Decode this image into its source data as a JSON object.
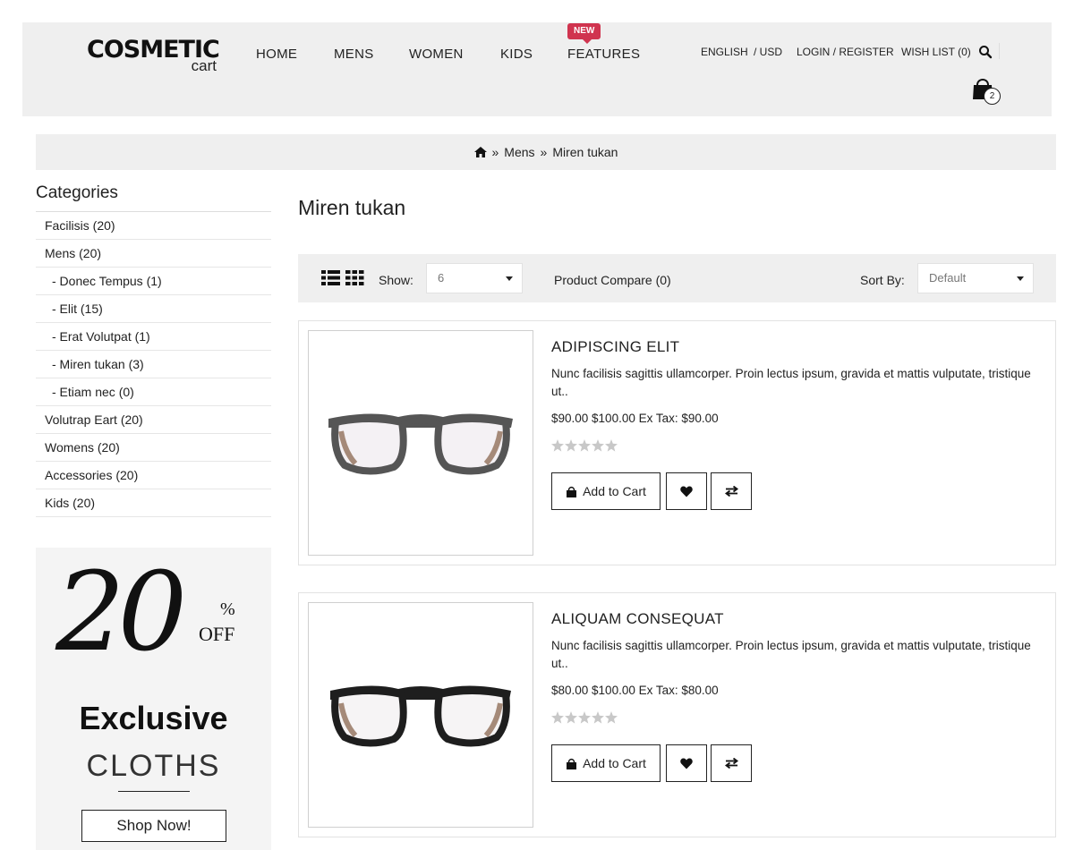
{
  "header": {
    "logo": {
      "main": "COSMETIC",
      "sub": "cart"
    },
    "nav": [
      "HOME",
      "MENS",
      "WOMEN",
      "KIDS",
      "FEATURES"
    ],
    "new_badge": "NEW",
    "language": "ENGLISH",
    "currency": "/ USD",
    "login": "LOGIN / REGISTER",
    "wishlist": "WISH LIST (0)",
    "cart_count": "2"
  },
  "breadcrumb": {
    "items": [
      "Mens",
      "Miren tukan"
    ],
    "separator": "»"
  },
  "sidebar": {
    "title": "Categories",
    "categories": [
      {
        "label": "Facilisis (20)",
        "sub": false
      },
      {
        "label": "Mens (20)",
        "sub": false
      },
      {
        "label": "- Donec Tempus (1)",
        "sub": true
      },
      {
        "label": "- Elit (15)",
        "sub": true
      },
      {
        "label": "- Erat Volutpat (1)",
        "sub": true
      },
      {
        "label": "- Miren tukan (3)",
        "sub": true
      },
      {
        "label": "- Etiam nec (0)",
        "sub": true
      },
      {
        "label": "Volutrap Eart (20)",
        "sub": false
      },
      {
        "label": "Womens (20)",
        "sub": false
      },
      {
        "label": "Accessories (20)",
        "sub": false
      },
      {
        "label": "Kids (20)",
        "sub": false
      }
    ],
    "promo": {
      "big": "20",
      "percent": "%",
      "off": "OFF",
      "headline": "Exclusive",
      "subline": "CLOTHS",
      "button": "Shop Now!"
    }
  },
  "main": {
    "title": "Miren tukan",
    "toolbar": {
      "show_label": "Show:",
      "show_value": "6",
      "compare": "Product Compare (0)",
      "sort_label": "Sort By:",
      "sort_value": "Default"
    },
    "products": [
      {
        "name": "ADIPISCING ELIT",
        "description": "Nunc facilisis sagittis ullamcorper. Proin lectus ipsum, gravida et mattis vulputate, tristique ut..",
        "price": "$90.00 $100.00 Ex Tax: $90.00",
        "rating": 0,
        "add_to_cart": "Add to Cart"
      },
      {
        "name": "ALIQUAM CONSEQUAT",
        "description": "Nunc facilisis sagittis ullamcorper. Proin lectus ipsum, gravida et mattis vulputate, tristique ut..",
        "price": "$80.00 $100.00 Ex Tax: $80.00",
        "rating": 0,
        "add_to_cart": "Add to Cart"
      }
    ]
  },
  "icons": {
    "home": "home-icon",
    "search": "search-icon",
    "cart": "shopping-bag-icon",
    "list_view": "list-view-icon",
    "grid_view": "grid-view-icon",
    "wishlist": "heart-icon",
    "compare": "compare-arrows-icon",
    "star": "star-icon"
  },
  "colors": {
    "header_bg": "#efefef",
    "badge": "#d0344f",
    "star_empty": "#c8c8c8",
    "text": "#222222"
  }
}
